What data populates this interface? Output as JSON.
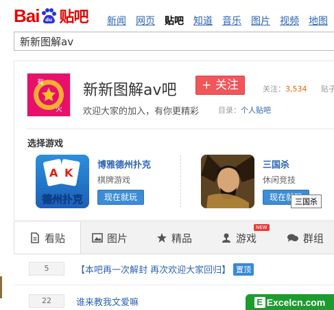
{
  "header": {
    "logo_bai": "Bai",
    "logo_tieba": "贴吧",
    "logo_du": "du",
    "nav": [
      "新闻",
      "网页",
      "贴吧",
      "知道",
      "音乐",
      "图片",
      "视频",
      "地图"
    ],
    "active_nav": "贴吧"
  },
  "search": {
    "value": "新新图解av"
  },
  "forum": {
    "avatar_text": [
      "有",
      "火"
    ],
    "title": "新新图解av吧",
    "follow_label": "+ 关注",
    "follow_count_label": "关注：",
    "follow_count": "3,534",
    "posts_label": "贴子",
    "slogan": "欢迎大家的加入，有你更精彩",
    "catalog_label": "目录：",
    "catalog_value": "个人贴吧"
  },
  "games": {
    "title": "选择游戏",
    "items": [
      {
        "name": "博雅德州扑克",
        "category": "棋牌游戏",
        "button": "现在就玩",
        "icon_text": "德州扑克",
        "icon": "poker-cards-icon"
      },
      {
        "name": "三国杀",
        "category": "休闲竞技",
        "button": "现在就玩",
        "icon": "warrior-portrait-icon"
      }
    ],
    "tooltip": "三国杀"
  },
  "tabs": [
    {
      "label": "看贴",
      "icon": "document-icon",
      "active": true
    },
    {
      "label": "图片",
      "icon": "image-icon"
    },
    {
      "label": "精品",
      "icon": "star-icon"
    },
    {
      "label": "游戏",
      "icon": "joystick-icon",
      "badge": "NEW"
    },
    {
      "label": "群组",
      "icon": "chat-icon"
    }
  ],
  "threads": [
    {
      "count": "5",
      "title": "【本吧再一次解封 再次欢迎大家回归】",
      "badge": "置顶"
    },
    {
      "count": "22",
      "title": "谁来教我文爱嘛"
    }
  ],
  "watermark": {
    "letter": "E",
    "text": "Excelcn.com"
  },
  "colors": {
    "brand_red": "#e10602",
    "link_blue": "#2d64b3",
    "follow_red": "#f0565a",
    "button_blue": "#3d8cd6",
    "watermark_green": "#1d9b2f"
  }
}
